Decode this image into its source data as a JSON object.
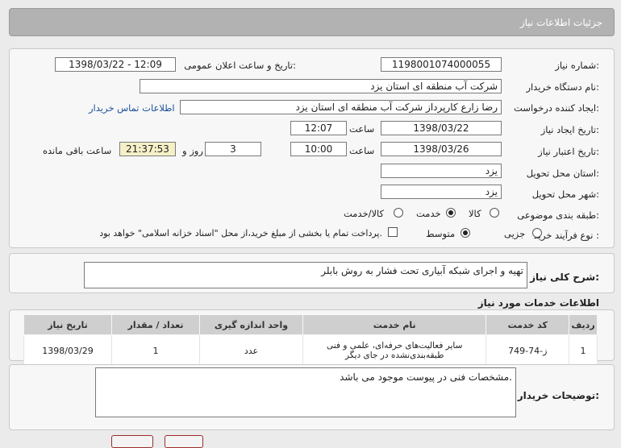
{
  "page": {
    "title": "جزئیات اطلاعات نیاز"
  },
  "form": {
    "need_number_label": "شماره نیاز:",
    "need_number": "1198001074000055",
    "announce_label": "تاریخ و ساعت اعلان عمومی:",
    "announce_value": "1398/03/22 - 12:09",
    "buyer_label": "نام دستگاه خریدار:",
    "buyer_value": "شرکت آب منطقه ای استان یزد",
    "creator_label": "ایجاد کننده درخواست:",
    "creator_value": "رضا زارع کارپرداز شرکت آب منطقه ای استان یزد",
    "contact_link": "اطلاعات تماس خریدار",
    "created_date_label": "تاریخ ایجاد نیاز:",
    "created_date": "1398/03/22",
    "hour_label": "ساعت",
    "created_time": "12:07",
    "validity_label": "تاریخ اعتبار نیاز:",
    "validity_date": "1398/03/26",
    "validity_time": "10:00",
    "days_value": "3",
    "days_label": "روز و",
    "remaining_time": "21:37:53",
    "remaining_label": "ساعت باقی مانده",
    "province_label": "استان محل تحویل:",
    "province_value": "یزد",
    "city_label": "شهر محل تحویل:",
    "city_value": "یزد",
    "category_label": "طبقه بندی موضوعی:",
    "category_options": [
      "کالا",
      "خدمت",
      "کالا/خدمت"
    ],
    "category_selected": "خدمت",
    "process_label": "نوع فرآیند خرید :",
    "process_options": [
      "جزیی",
      "متوسط"
    ],
    "process_selected": "متوسط",
    "payment_note": "پرداخت تمام یا بخشی از مبلغ خرید،از محل \"اسناد خزانه اسلامی\" خواهد بود."
  },
  "summary": {
    "label": "شرح کلی نیاز:",
    "value": "تهیه و اجرای شبکه آبیاری تحت فشار  به روش بابلر"
  },
  "services": {
    "title": "اطلاعات خدمات مورد نیاز",
    "columns": [
      "ردیف",
      "کد خدمت",
      "نام خدمت",
      "واحد اندازه گیری",
      "تعداد / مقدار",
      "تاریخ نیاز"
    ],
    "rows": [
      {
        "row": "1",
        "code": "ز-74-749",
        "name": "سایر فعالیت‌های حرفه‌ای، علمی و فنی طبقه‌بندی‌نشده در جای دیگر",
        "unit": "عدد",
        "qty": "1",
        "date": "1398/03/29"
      }
    ]
  },
  "buyer_notes": {
    "label": "توضیحات خریدار:",
    "value": "مشخصات فنی در پیوست موجود می باشد."
  },
  "colors": {
    "header": "#b2b2b2",
    "panel": "#f7f7f7",
    "table_head": "#cfcfcf",
    "link": "#1a4f9c",
    "highlight": "#f6f0c8"
  }
}
